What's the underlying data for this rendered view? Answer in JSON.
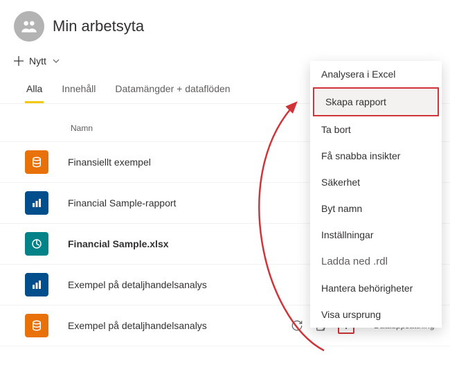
{
  "header": {
    "title": "Min arbetsyta"
  },
  "toolbar": {
    "new_label": "Nytt"
  },
  "tabs": {
    "all": "Alla",
    "content": "Innehåll",
    "datasets": "Datamängder + dataflöden"
  },
  "columns": {
    "name": "Namn"
  },
  "rows": [
    {
      "name": "Finansiellt exempel"
    },
    {
      "name": "Financial Sample-rapport"
    },
    {
      "name": "Financial Sample.xlsx"
    },
    {
      "name": "Exempel  på  detaljhandelsanalys"
    },
    {
      "name": "Exempel på detaljhandelsanalys",
      "type": "Datauppsättning"
    }
  ],
  "menu": {
    "analyze": "Analysera i Excel",
    "create_report": "Skapa rapport",
    "delete": "Ta bort",
    "quick_insights": "Få snabba insikter",
    "security": "Säkerhet",
    "rename": "Byt namn",
    "settings": "Inställningar",
    "download_rdl": "Ladda ned .rdl",
    "manage_permissions": "Hantera behörigheter",
    "view_lineage": "Visa ursprung"
  }
}
